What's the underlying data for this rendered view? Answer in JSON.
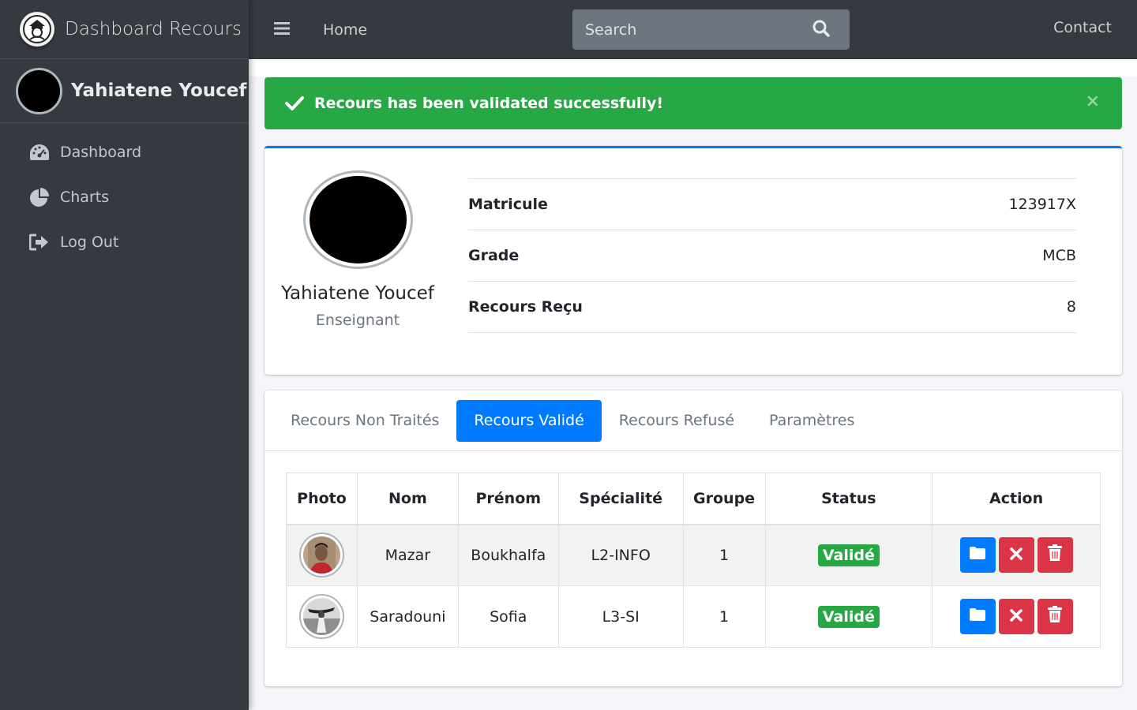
{
  "brand": {
    "title": "Dashboard Recours"
  },
  "sidebar": {
    "user_name": "Yahiatene Youcef",
    "items": [
      {
        "label": "Dashboard",
        "icon": "tachometer-icon"
      },
      {
        "label": "Charts",
        "icon": "pie-chart-icon"
      },
      {
        "label": "Log Out",
        "icon": "sign-out-icon"
      }
    ]
  },
  "topbar": {
    "home_label": "Home",
    "search_placeholder": "Search",
    "contact_label": "Contact"
  },
  "alert": {
    "message": "Recours has been validated successfully!",
    "close_label": "×",
    "color": "#28a745"
  },
  "profile": {
    "name": "Yahiatene Youcef",
    "role": "Enseignant",
    "fields": [
      {
        "label": "Matricule",
        "value": "123917X"
      },
      {
        "label": "Grade",
        "value": "MCB"
      },
      {
        "label": "Recours Reçu",
        "value": "8"
      }
    ]
  },
  "tabs": [
    {
      "label": "Recours Non Traités",
      "active": false
    },
    {
      "label": "Recours Validé",
      "active": true
    },
    {
      "label": "Recours Refusé",
      "active": false
    },
    {
      "label": "Paramètres",
      "active": false
    }
  ],
  "table": {
    "headers": [
      "Photo",
      "Nom",
      "Prénom",
      "Spécialité",
      "Groupe",
      "Status",
      "Action"
    ],
    "rows": [
      {
        "nom": "Mazar",
        "prenom": "Boukhalfa",
        "specialite": "L2-INFO",
        "groupe": "1",
        "status": "Validé"
      },
      {
        "nom": "Saradouni",
        "prenom": "Sofia",
        "specialite": "L3-SI",
        "groupe": "1",
        "status": "Validé"
      }
    ]
  },
  "colors": {
    "sidebar_bg": "#343a40",
    "primary": "#007bff",
    "success": "#28a745",
    "danger": "#dc3545"
  }
}
